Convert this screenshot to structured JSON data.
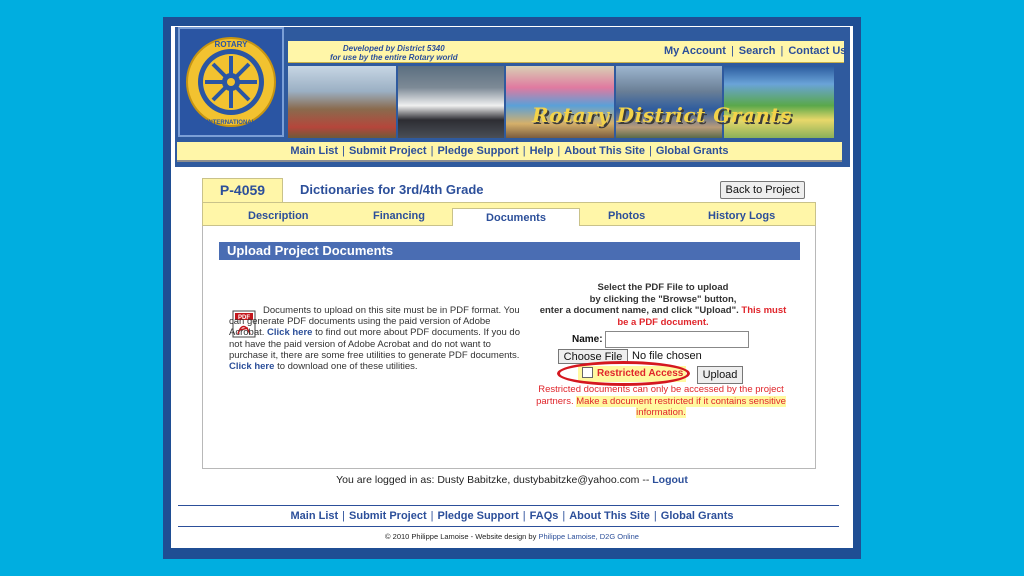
{
  "header": {
    "developed_line1": "Developed by District 5340",
    "developed_line2": "for use by the entire Rotary world",
    "top_links": [
      "My Account",
      "Search",
      "Contact Us"
    ],
    "banner_title": "Rotary District Grants",
    "logo_top_text": "ROTARY",
    "logo_bottom_text": "INTERNATIONAL"
  },
  "nav": [
    "Main List",
    "Submit Project",
    "Pledge Support",
    "Help",
    "About This Site",
    "Global Grants"
  ],
  "project": {
    "id": "P-4059",
    "title": "Dictionaries for 3rd/4th Grade",
    "back_label": "Back to Project"
  },
  "tabs": [
    "Description",
    "Financing",
    "Documents",
    "Photos",
    "History Logs"
  ],
  "active_tab": "Documents",
  "section_title": "Upload Project Documents",
  "info": {
    "pdf_icon_text": "PDF",
    "p1": "Documents to upload on this site must be in PDF format. You can generate PDF documents using the paid version of Adobe Acrobat.",
    "link1": "Click here",
    "p2": "to find out more about PDF documents. If you do not have the paid version of Adobe Acrobat and do not want to purchase it, there are some free utilities to generate PDF documents.",
    "link2": "Click here",
    "p3": "to download one of these utilities."
  },
  "upload": {
    "instr1": "Select the PDF File to upload",
    "instr2": "by clicking the \"Browse\" button,",
    "instr3": "enter a document name, and click \"Upload\".",
    "instr_red1": "This must",
    "instr_red2": "be a PDF document.",
    "name_label": "Name:",
    "name_value": "",
    "choose_label": "Choose File",
    "no_file": "No file chosen",
    "restricted_label": "Restricted Access",
    "upload_label": "Upload",
    "warn1": "Restricted documents can only be accessed by the project partners.",
    "warn2": "Make a document restricted if it contains sensitive information."
  },
  "login": {
    "prefix": "You are logged in as: Dusty Babitzke, dustybabitzke@yahoo.com --",
    "logout": "Logout"
  },
  "footer_nav": [
    "Main List",
    "Submit Project",
    "Pledge Support",
    "FAQs",
    "About This Site",
    "Global Grants"
  ],
  "copyright": {
    "prefix": "© 2010 Philippe Lamoise - Website design by",
    "link": "Philippe Lamoise, D2G Online"
  },
  "colors": {
    "background": "#00aee0",
    "brand_blue": "#2c4f9a",
    "nav_yellow": "#fff6a8",
    "alert_red": "#e0252b"
  }
}
